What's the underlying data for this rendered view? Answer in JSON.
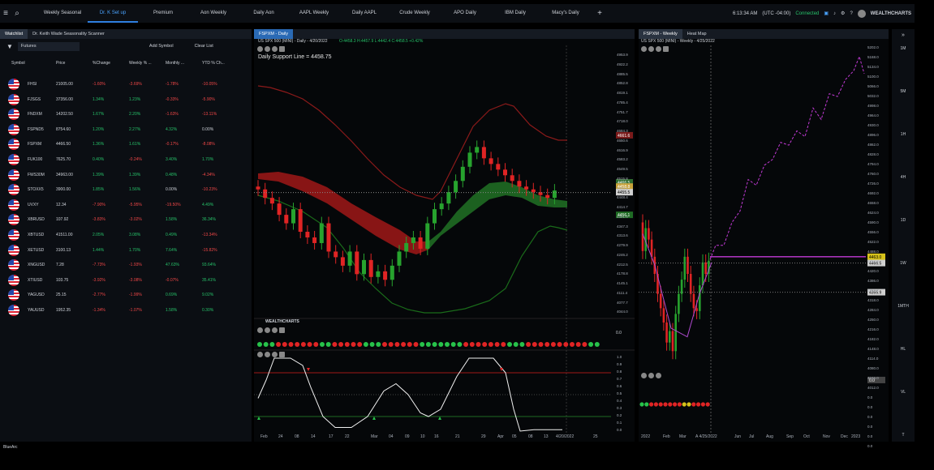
{
  "topbar": {
    "tabs": [
      "Weekly Seasonal",
      "Dr. K Set up",
      "Premium",
      "Aon Weekly",
      "Daily Aon",
      "AAPL Weekly",
      "Daily AAPL",
      "Crude Weekly",
      "APO Daily",
      "IBM Daily",
      "Macy's Daily"
    ],
    "active": 1,
    "time": "6:13:34 AM",
    "tz": "(UTC -04:00)",
    "status": "Connected",
    "brand": "WEALTHCHARTS"
  },
  "watchlist": {
    "tabs": [
      "Watchlist",
      "Dr. Keith Wade Seasonality Scanner"
    ],
    "filter": "Futures",
    "add": "Add Symbol",
    "clear": "Clear List",
    "headers": [
      "Symbol",
      "Price",
      "%Change",
      "Weekly % ...",
      "Monthly ...",
      "YTD % Ch..."
    ],
    "rows": [
      [
        "FHSI",
        "21005.00",
        "-1.60%",
        "-3.69%",
        "-1.78%",
        "-10.05%"
      ],
      [
        "FJSGS",
        "37356.00",
        "1.34%",
        "1.23%",
        "-0.33%",
        "-5.90%"
      ],
      [
        "FNDXM",
        "14202.50",
        "1.67%",
        "2.20%",
        "-1.63%",
        "-13.11%"
      ],
      [
        "FSPND5",
        "8754.60",
        "1.20%",
        "2.27%",
        "4.32%",
        "0.00%"
      ],
      [
        "FSPXM",
        "4466.50",
        "1.36%",
        "1.61%",
        "-0.17%",
        "-8.08%"
      ],
      [
        "FUK100",
        "7625.70",
        "0.40%",
        "-0.24%",
        "3.40%",
        "1.70%"
      ],
      [
        "FWS30M",
        "34963.00",
        "1.39%",
        "1.39%",
        "0.48%",
        "-4.34%"
      ],
      [
        "STOXX5",
        "3900.00",
        "1.85%",
        "1.56%",
        "0.00%",
        "-10.23%"
      ],
      [
        "UVXY",
        "12.34",
        "-7.90%",
        "-5.95%",
        "-19.50%",
        "4.49%"
      ],
      [
        "XBRUSD",
        "107.92",
        "-3.83%",
        "-3.02%",
        "1.58%",
        "36.34%"
      ],
      [
        "XBTUSD",
        "41511.00",
        "2.05%",
        "3.08%",
        "0.49%",
        "-13.34%"
      ],
      [
        "XETUSD",
        "3100.13",
        "1.44%",
        "1.70%",
        "7.64%",
        "-15.82%"
      ],
      [
        "XNGUSD",
        "7.28",
        "-7.73%",
        "-1.93%",
        "47.63%",
        "93.64%"
      ],
      [
        "XTIUSD",
        "103.75",
        "-3.92%",
        "-3.08%",
        "-0.07%",
        "35.41%"
      ],
      [
        "YAGUSD",
        "25.15",
        "-2.77%",
        "-1.99%",
        "0.69%",
        "9.02%"
      ],
      [
        "YAUUSD",
        "1952.35",
        "-1.34%",
        "-1.07%",
        "1.58%",
        "0.30%"
      ]
    ]
  },
  "daily": {
    "tab": "FSPXM - Daily",
    "info": "US SPX 500 (MINI) - Daily - 4/20/2022",
    "ohlc": "O:4458.3 H:4457.9 L:4442.4 C:4458.5 +0.42%",
    "support": "Daily Support Line = 4458.75",
    "yticks": [
      "4953.9",
      "4922.2",
      "4885.5",
      "4852.8",
      "4819.1",
      "4785.4",
      "4751.7",
      "4718.0",
      "4684.3",
      "4650.6",
      "4616.9",
      "4583.2",
      "4549.5",
      "4515.8",
      "4482.1",
      "4448.4",
      "4414.7",
      "4381.0",
      "4347.3",
      "4313.6",
      "4279.9",
      "4246.2",
      "4212.5",
      "4178.8",
      "4145.1",
      "4111.4",
      "4077.7",
      "4044.0"
    ],
    "tags": [
      "4661.6",
      "4466.5",
      "4458.8",
      "4455.5",
      "4456.1"
    ],
    "xticks": [
      "Feb",
      "24",
      "08",
      "14",
      "17",
      "22",
      "Mar",
      "04",
      "09",
      "10",
      "16",
      "21",
      "29",
      "Apr",
      "05",
      "08",
      "13",
      "4/20/2022",
      "25"
    ],
    "ind_yticks": [
      "1.0",
      "0.9",
      "0.8",
      "0.7",
      "0.6",
      "0.5",
      "0.4",
      "0.3",
      "0.2",
      "0.1",
      "0.0"
    ],
    "ind0": "0.0",
    "logo": "WEALTHCHARTS"
  },
  "weekly": {
    "tabs": [
      "FSPXM - Weekly",
      "Heat Map"
    ],
    "info": "US SPX 500 (MINI) - Weekly - 4/25/2022",
    "yticks": [
      "5202.0",
      "5168.0",
      "5134.0",
      "5100.0",
      "5066.0",
      "5032.0",
      "4998.0",
      "4964.0",
      "4930.0",
      "4896.0",
      "4862.0",
      "4828.0",
      "4794.0",
      "4760.0",
      "4726.0",
      "4692.0",
      "4658.0",
      "4624.0",
      "4590.0",
      "4556.0",
      "4522.0",
      "4488.0",
      "4454.0",
      "4420.0",
      "4386.0",
      "4352.0",
      "4318.0",
      "4284.0",
      "4250.0",
      "4216.0",
      "4182.0",
      "4148.0",
      "4114.0",
      "4080.0",
      "4046.0",
      "4012.0",
      "0.0",
      "0.0",
      "0.0",
      "0.0",
      "0.0",
      "0.0"
    ],
    "tags": [
      "4463.0",
      "4466.5",
      "4355.9",
      "0.0"
    ],
    "xticks": [
      "2022",
      "Feb",
      "Mar",
      "A 4/25/2022",
      "Jun",
      "Jul",
      "Aug",
      "Sep",
      "Oct",
      "Nov",
      "Dec",
      "2023"
    ]
  },
  "side": [
    "1M",
    "5M",
    "1H",
    "4H",
    "1D",
    "1W",
    "1MTH",
    "HL",
    "VL",
    "T"
  ],
  "status": "BlueArc"
}
